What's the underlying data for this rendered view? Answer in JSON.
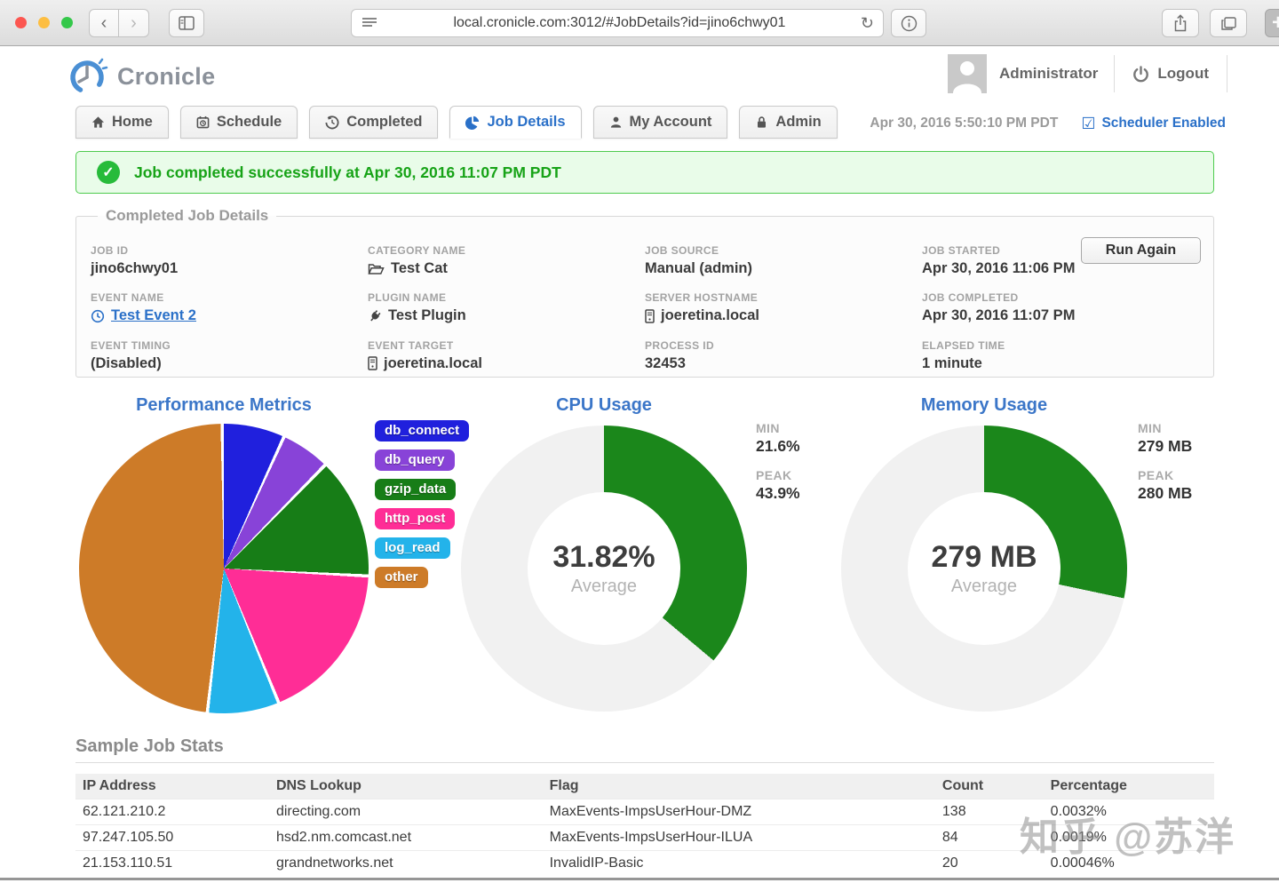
{
  "browser": {
    "url": "local.cronicle.com:3012/#JobDetails?id=jino6chwy01",
    "new_tab_label": "+"
  },
  "header": {
    "brand": "Cronicle",
    "user": "Administrator",
    "logout_label": "Logout"
  },
  "tabs": {
    "items": [
      {
        "label": "Home"
      },
      {
        "label": "Schedule"
      },
      {
        "label": "Completed"
      },
      {
        "label": "Job Details"
      },
      {
        "label": "My Account"
      },
      {
        "label": "Admin"
      }
    ],
    "active": "Job Details",
    "clock": "Apr 30, 2016 5:50:10 PM PDT",
    "scheduler_checkbox": "☑",
    "scheduler_label": "Scheduler Enabled"
  },
  "banner": {
    "check": "✓",
    "message": "Job completed successfully at Apr 30, 2016 11:07 PM PDT"
  },
  "job": {
    "legend": "Completed Job Details",
    "run_again_label": "Run Again",
    "columns": [
      [
        {
          "label": "JOB ID",
          "value": "jino6chwy01"
        },
        {
          "label": "EVENT NAME",
          "value": "Test Event 2",
          "icon": "clock-icon",
          "link": true
        },
        {
          "label": "EVENT TIMING",
          "value": "(Disabled)"
        }
      ],
      [
        {
          "label": "CATEGORY NAME",
          "value": "Test Cat",
          "icon": "folder-open-icon"
        },
        {
          "label": "PLUGIN NAME",
          "value": "Test Plugin",
          "icon": "plug-icon"
        },
        {
          "label": "EVENT TARGET",
          "value": "joeretina.local",
          "icon": "server-icon"
        }
      ],
      [
        {
          "label": "JOB SOURCE",
          "value": "Manual (admin)"
        },
        {
          "label": "SERVER HOSTNAME",
          "value": "joeretina.local",
          "icon": "server-icon"
        },
        {
          "label": "PROCESS ID",
          "value": "32453"
        }
      ],
      [
        {
          "label": "JOB STARTED",
          "value": "Apr 30, 2016 11:06 PM"
        },
        {
          "label": "JOB COMPLETED",
          "value": "Apr 30, 2016 11:07 PM"
        },
        {
          "label": "ELAPSED TIME",
          "value": "1 minute"
        }
      ]
    ]
  },
  "chart_data": [
    {
      "type": "pie",
      "title": "Performance Metrics",
      "categories": [
        "db_connect",
        "db_query",
        "gzip_data",
        "http_post",
        "log_read",
        "other"
      ],
      "values": [
        7,
        5.5,
        13.5,
        18,
        8,
        48
      ],
      "unit": "percent",
      "colors": [
        "#2020dd",
        "#8843d8",
        "#177d17",
        "#ff2d96",
        "#23b3ea",
        "#cd7b28"
      ],
      "legend_position": "right",
      "start_angle_deg": 0
    },
    {
      "type": "donut",
      "title": "CPU Usage",
      "center_value": "31.82%",
      "center_label": "Average",
      "min_label": "MIN",
      "min_value": "21.6%",
      "peak_label": "PEAK",
      "peak_value": "43.9%",
      "arc_deg": 130,
      "color": "#1b871b",
      "track_color": "#f1f1f1"
    },
    {
      "type": "donut",
      "title": "Memory Usage",
      "center_value": "279 MB",
      "center_label": "Average",
      "min_label": "MIN",
      "min_value": "279 MB",
      "peak_label": "PEAK",
      "peak_value": "280 MB",
      "arc_deg": 102,
      "color": "#1b871b",
      "track_color": "#f1f1f1"
    }
  ],
  "stats": {
    "heading": "Sample Job Stats",
    "columns": [
      "IP Address",
      "DNS Lookup",
      "Flag",
      "Count",
      "Percentage"
    ],
    "rows": [
      [
        "62.121.210.2",
        "directing.com",
        "MaxEvents-ImpsUserHour-DMZ",
        "138",
        "0.0032%"
      ],
      [
        "97.247.105.50",
        "hsd2.nm.comcast.net",
        "MaxEvents-ImpsUserHour-ILUA",
        "84",
        "0.0019%"
      ],
      [
        "21.153.110.51",
        "grandnetworks.net",
        "InvalidIP-Basic",
        "20",
        "0.00046%"
      ]
    ]
  },
  "watermark": "知乎 @苏洋"
}
